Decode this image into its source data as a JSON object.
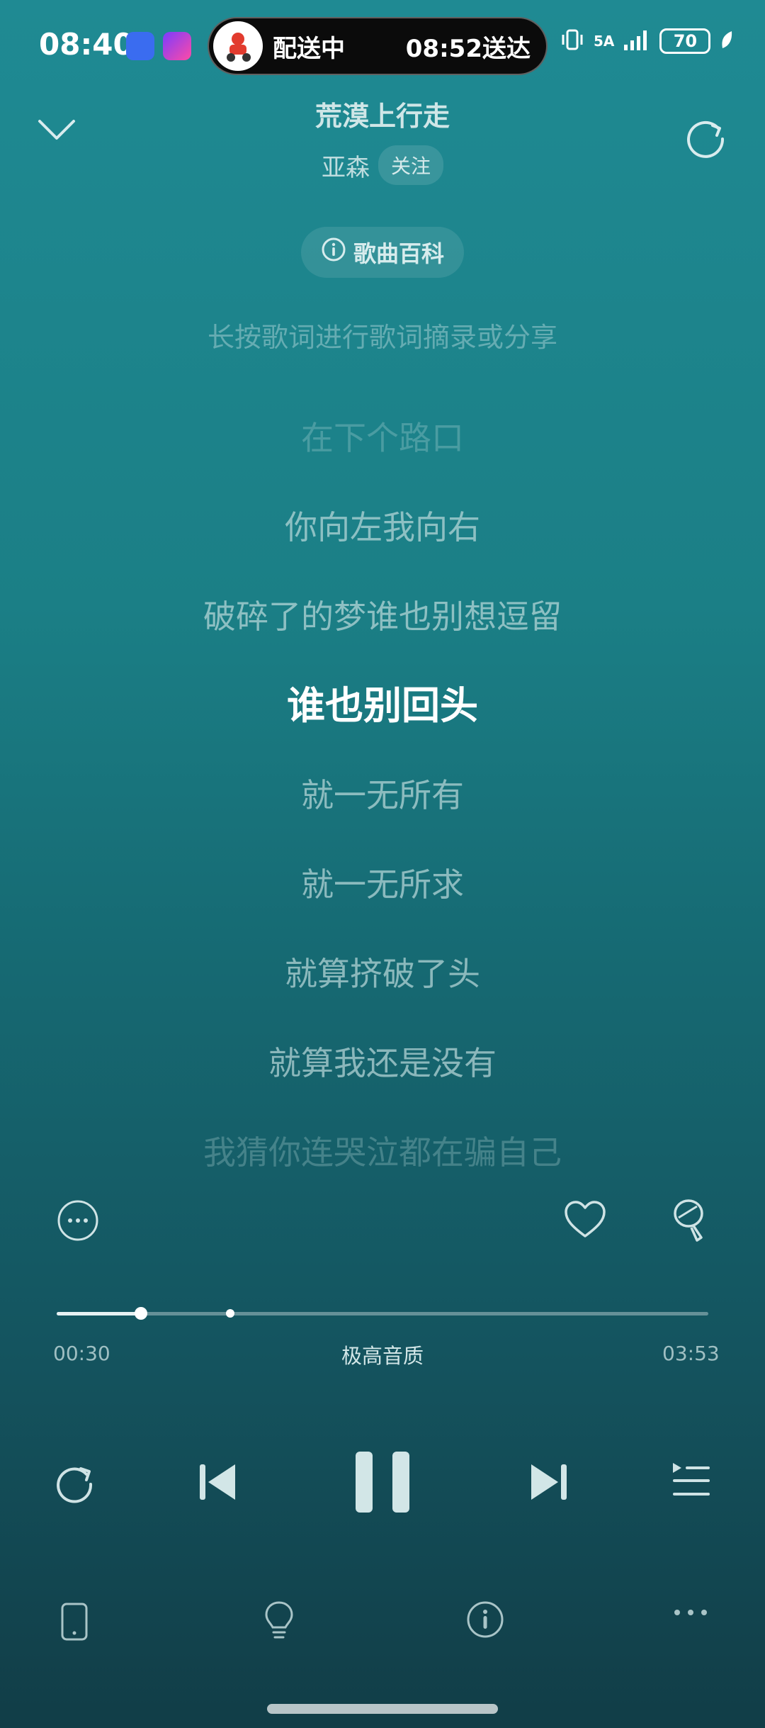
{
  "status_bar": {
    "time": "08:40",
    "delivery": {
      "status": "配送中",
      "eta": "08:52送达"
    },
    "network": "5A",
    "battery": "70"
  },
  "header": {
    "title": "荒漠上行走",
    "artist": "亚森",
    "follow_label": "关注",
    "wiki_label": "歌曲百科",
    "hint": "长按歌词进行歌词摘录或分享"
  },
  "lyrics": {
    "lines": [
      "在下个路口",
      "你向左我向右",
      "破碎了的梦谁也别想逗留",
      "谁也别回头",
      "就一无所有",
      "就一无所求",
      "就算挤破了头",
      "就算我还是没有",
      "我猜你连哭泣都在骗自己"
    ],
    "current_index": 3
  },
  "player": {
    "elapsed": "00:30",
    "duration": "03:53",
    "quality_label": "极高音质",
    "progress_fraction": 0.129,
    "buffered_fraction": 0.266
  },
  "icons": {
    "collapse": "chevron-down-icon",
    "refresh": "refresh-icon",
    "more": "more-circle-icon",
    "like": "heart-icon",
    "brush": "brush-icon",
    "repeat": "repeat-icon",
    "prev": "skip-previous-icon",
    "pause": "pause-icon",
    "next": "skip-next-icon",
    "playlist": "playlist-icon",
    "device": "phone-device-icon",
    "tip": "lightbulb-icon",
    "info": "info-icon",
    "overflow": "more-horizontal-icon"
  },
  "colors": {
    "accent": "#1f8a93",
    "bg_bottom": "#113d47",
    "text_primary": "#ffffff"
  }
}
